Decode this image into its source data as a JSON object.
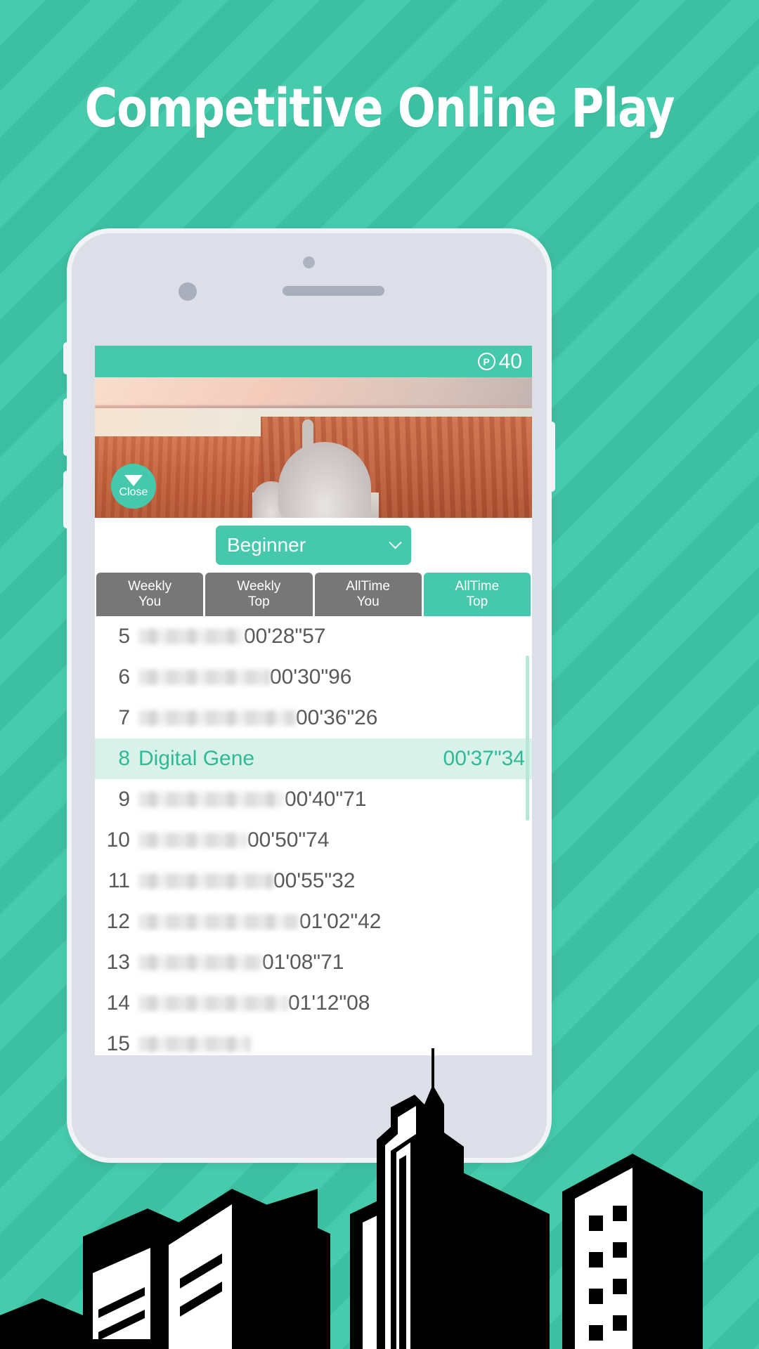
{
  "headline": "Competitive Online Play",
  "screen": {
    "topbar": {
      "coin_icon": "points-coin-icon",
      "coin_symbol": "P",
      "coin_count": "40"
    },
    "hero": {
      "alt": "aerial-city-photo"
    },
    "close_button": {
      "label": "Close",
      "icon": "triangle-down-icon"
    },
    "difficulty": {
      "value": "Beginner",
      "icon": "chevron-down-icon"
    },
    "tabs": [
      {
        "line1": "Weekly",
        "line2": "You",
        "active": false
      },
      {
        "line1": "Weekly",
        "line2": "Top",
        "active": false
      },
      {
        "line1": "AllTime",
        "line2": "You",
        "active": false
      },
      {
        "line1": "AllTime",
        "line2": "Top",
        "active": true
      }
    ],
    "leaderboard": {
      "rows": [
        {
          "rank": "5",
          "name": "",
          "blurred": true,
          "time": "00'28\"57",
          "highlight": false
        },
        {
          "rank": "6",
          "name": "",
          "blurred": true,
          "time": "00'30\"96",
          "highlight": false
        },
        {
          "rank": "7",
          "name": "",
          "blurred": true,
          "time": "00'36\"26",
          "highlight": false
        },
        {
          "rank": "8",
          "name": "Digital Gene",
          "blurred": false,
          "time": "00'37\"34",
          "highlight": true
        },
        {
          "rank": "9",
          "name": "",
          "blurred": true,
          "time": "00'40\"71",
          "highlight": false
        },
        {
          "rank": "10",
          "name": "",
          "blurred": true,
          "time": "00'50\"74",
          "highlight": false
        },
        {
          "rank": "11",
          "name": "",
          "blurred": true,
          "time": "00'55\"32",
          "highlight": false
        },
        {
          "rank": "12",
          "name": "",
          "blurred": true,
          "time": "01'02\"42",
          "highlight": false
        },
        {
          "rank": "13",
          "name": "",
          "blurred": true,
          "time": "01'08\"71",
          "highlight": false
        },
        {
          "rank": "14",
          "name": "",
          "blurred": true,
          "time": "01'12\"08",
          "highlight": false
        },
        {
          "rank": "15",
          "name": "",
          "blurred": true,
          "time": "",
          "highlight": false
        }
      ]
    }
  },
  "colors": {
    "accent": "#45c8ac",
    "bg_stripe_light": "#46cbad",
    "bg_stripe_dark": "#3dbfa2",
    "tab_inactive": "#777777",
    "row_highlight_bg": "#d9f2e9",
    "row_highlight_text": "#2fba97",
    "phone_body": "#dcdfe8",
    "phone_bezel": "#f2f3f7"
  }
}
